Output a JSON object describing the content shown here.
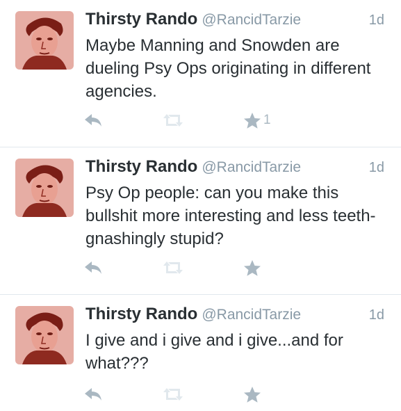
{
  "tweets": [
    {
      "name": "Thirsty Rando",
      "handle": "@RancidTarzie",
      "time": "1d",
      "text": "Maybe Manning and Snowden are dueling Psy Ops originating in different agencies.",
      "favorites": "1",
      "icons": {
        "avatar": "profile-photo",
        "reply": "reply-icon",
        "retweet": "retweet-icon",
        "favorite": "star-icon"
      }
    },
    {
      "name": "Thirsty Rando",
      "handle": "@RancidTarzie",
      "time": "1d",
      "text": "Psy Op people: can you make this bullshit more interesting and less teeth-gnashingly stupid?",
      "favorites": "",
      "icons": {
        "avatar": "profile-photo",
        "reply": "reply-icon",
        "retweet": "retweet-icon",
        "favorite": "star-icon"
      }
    },
    {
      "name": "Thirsty Rando",
      "handle": "@RancidTarzie",
      "time": "1d",
      "text": "I give and i give and i give...and for what???",
      "favorites": "",
      "icons": {
        "avatar": "profile-photo",
        "reply": "reply-icon",
        "retweet": "retweet-icon",
        "favorite": "star-icon"
      }
    }
  ],
  "colors": {
    "text": "#292f33",
    "muted": "#8899a6",
    "icon": "#aab8c2",
    "divider": "#e1e8ed",
    "avatar_tint": "#b8463a"
  }
}
